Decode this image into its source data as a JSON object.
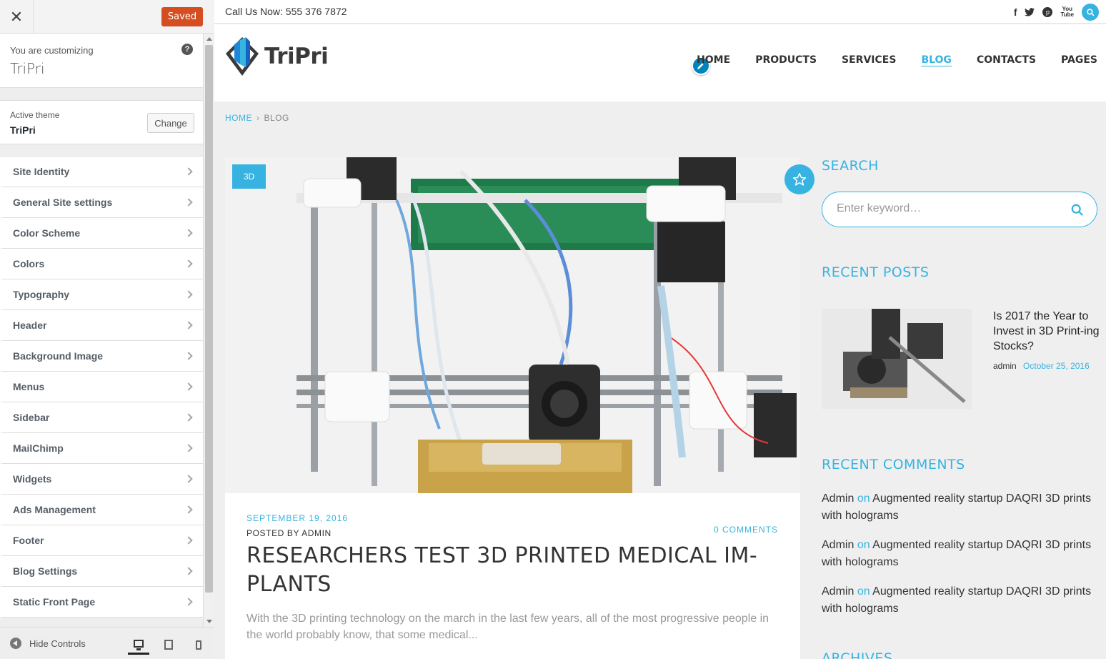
{
  "customizer": {
    "close_label": "✕",
    "status_label": "Saved",
    "info": {
      "customizing_label": "You are customizing",
      "site_name": "TriPri",
      "help_label": "?"
    },
    "theme": {
      "active_label": "Active theme",
      "name": "TriPri",
      "change_label": "Change"
    },
    "sections": [
      {
        "label": "Site Identity"
      },
      {
        "label": "General Site settings"
      },
      {
        "label": "Color Scheme"
      },
      {
        "label": "Colors"
      },
      {
        "label": "Typography"
      },
      {
        "label": "Header"
      },
      {
        "label": "Background Image"
      },
      {
        "label": "Menus"
      },
      {
        "label": "Sidebar"
      },
      {
        "label": "MailChimp"
      },
      {
        "label": "Widgets"
      },
      {
        "label": "Ads Management"
      },
      {
        "label": "Footer"
      },
      {
        "label": "Blog Settings"
      },
      {
        "label": "Static Front Page"
      }
    ],
    "footer": {
      "hide_label": "Hide Controls",
      "active_device": "desktop"
    }
  },
  "site": {
    "topbar": {
      "call": "Call Us Now: 555 376 7872",
      "social_icons": [
        "facebook-icon",
        "twitter-icon",
        "pinterest-icon",
        "youtube-icon",
        "search-icon"
      ],
      "youtube_top": "You",
      "youtube_bottom": "Tube"
    },
    "logo_text": "TriPri",
    "nav": [
      {
        "label": "HOME",
        "active": false
      },
      {
        "label": "PRODUCTS",
        "active": false
      },
      {
        "label": "SERVICES",
        "active": false
      },
      {
        "label": "BLOG",
        "active": true
      },
      {
        "label": "CONTACTS",
        "active": false
      },
      {
        "label": "PAGES",
        "active": false
      }
    ],
    "breadcrumb": {
      "home": "HOME",
      "separator": "›",
      "current": "BLOG"
    },
    "post": {
      "category": "3D",
      "date": "SEPTEMBER 19, 2016",
      "posted_by": "POSTED BY ADMIN",
      "comments": "0 COMMENTS",
      "title": "RESEARCHERS TEST 3D PRINTED MEDICAL IM-PLANTS",
      "excerpt": "With the 3D printing technology on the march in the last few years, all of the most progressive people in the world probably know, that some medical..."
    },
    "sidebar": {
      "search_title": "SEARCH",
      "search_placeholder": "Enter keyword…",
      "recent_posts_title": "RECENT POSTS",
      "recent_post": {
        "title": "Is 2017 the Year to Invest in 3D Print-ing Stocks?",
        "author": "admin",
        "date": "October 25, 2016"
      },
      "recent_comments_title": "RECENT COMMENTS",
      "comments": [
        {
          "author": "Admin",
          "on": "on",
          "post": "Augmented reality startup DAQRI 3D prints with holograms"
        },
        {
          "author": "Admin",
          "on": "on",
          "post": "Augmented reality startup DAQRI 3D prints with holograms"
        },
        {
          "author": "Admin",
          "on": "on",
          "post": "Augmented reality startup DAQRI 3D prints with holograms"
        }
      ],
      "archives_title": "ARCHIVES"
    },
    "colors": {
      "accent": "#36b3e1",
      "saved_button": "#d54e21",
      "edit_pencil": "#0085ba"
    }
  }
}
